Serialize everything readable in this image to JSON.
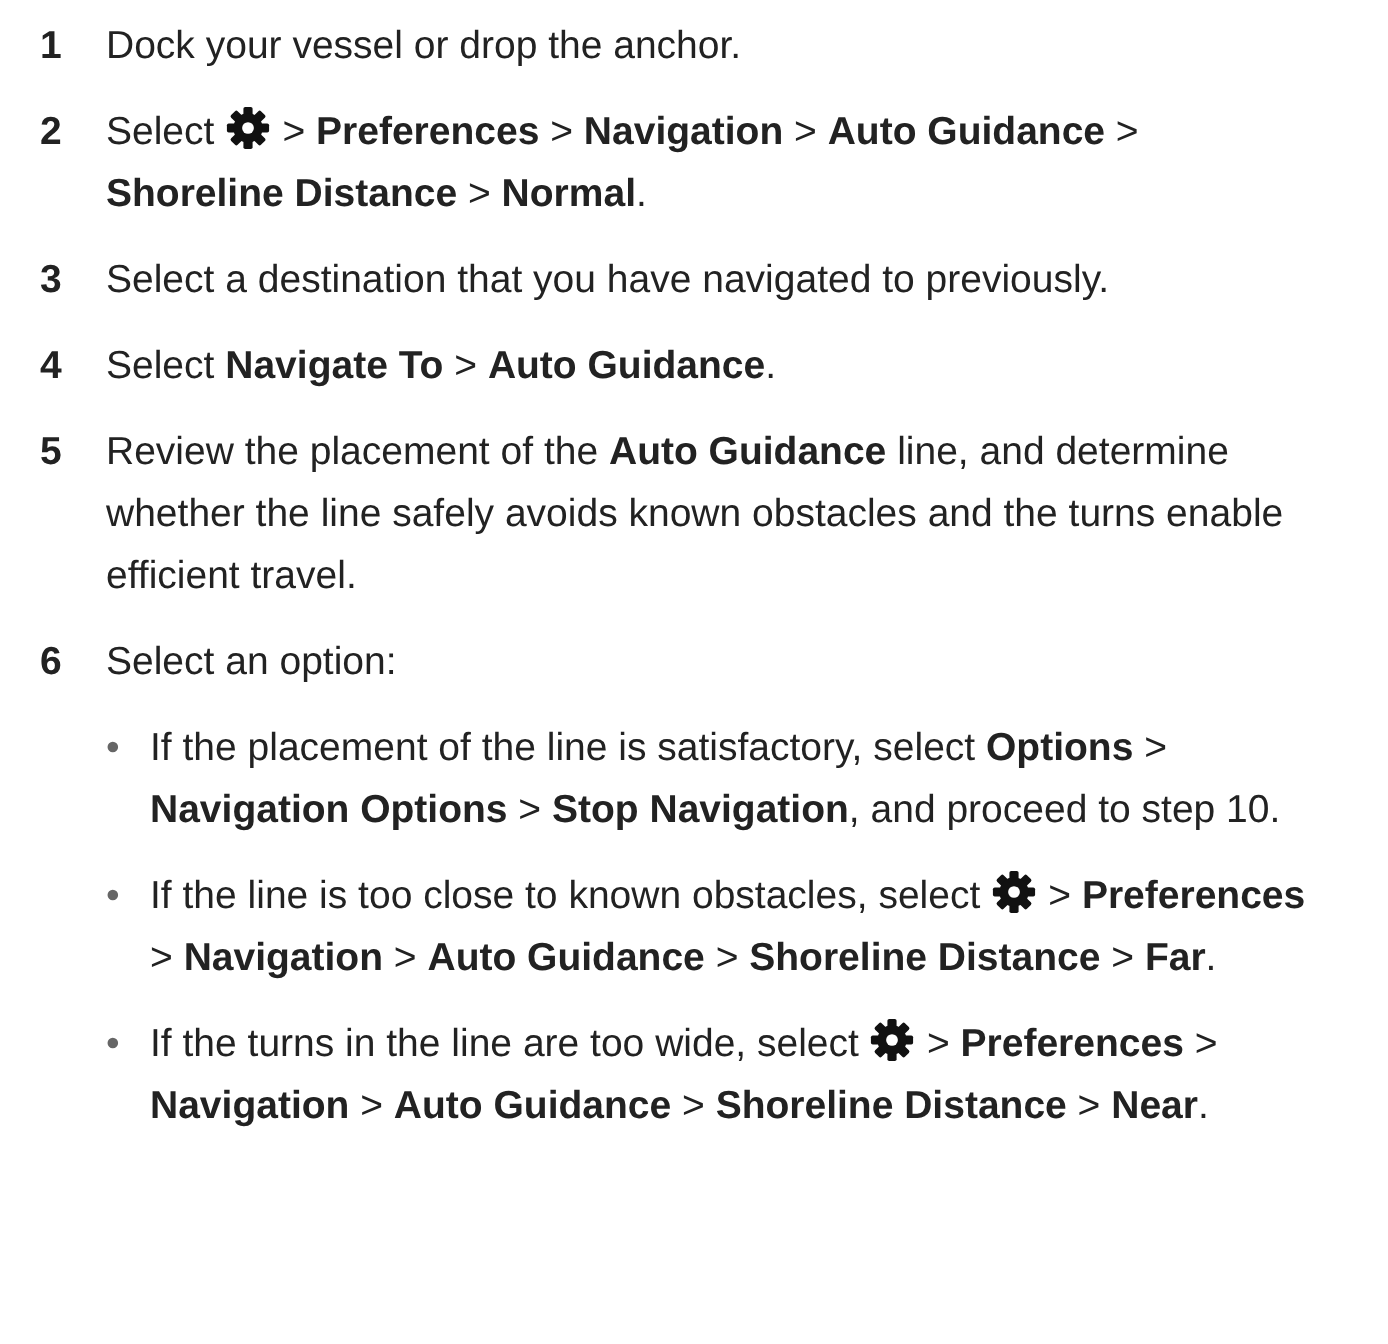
{
  "steps": [
    {
      "number": "1",
      "segments": [
        {
          "kind": "text",
          "text": "Dock your vessel or drop the anchor."
        }
      ]
    },
    {
      "number": "2",
      "segments": [
        {
          "kind": "text",
          "text": "Select"
        },
        {
          "kind": "gear"
        },
        {
          "kind": "text",
          "text": "> **Preferences** > **Navigation** > **Auto Guidance** > **Shoreline Distance** > **Normal**."
        }
      ]
    },
    {
      "number": "3",
      "segments": [
        {
          "kind": "text",
          "text": "Select a destination that you have navigated to previously."
        }
      ]
    },
    {
      "number": "4",
      "segments": [
        {
          "kind": "text",
          "text": "Select **Navigate To** > **Auto Guidance**."
        }
      ]
    },
    {
      "number": "5",
      "segments": [
        {
          "kind": "text",
          "text": "Review the placement of the **Auto Guidance** line, and determine whether the line safely avoids known obstacles and the turns enable efficient travel."
        }
      ]
    },
    {
      "number": "6",
      "segments": [
        {
          "kind": "text",
          "text": "Select an option:"
        }
      ],
      "options": [
        {
          "bullet": "•",
          "segments": [
            {
              "kind": "text",
              "text": "If the placement of the line is satisfactory, select **Options** > **Navigation Options** > **Stop Navigation**, and proceed to step 10."
            }
          ]
        },
        {
          "bullet": "•",
          "segments": [
            {
              "kind": "text",
              "text": "If the line is too close to known obstacles, select"
            },
            {
              "kind": "gear"
            },
            {
              "kind": "text",
              "text": "> **Preferences** > **Navigation** > **Auto Guidance** > **Shoreline Distance** > **Far**."
            }
          ]
        },
        {
          "bullet": "•",
          "segments": [
            {
              "kind": "text",
              "text": "If the turns in the line are too wide, select"
            },
            {
              "kind": "gear"
            },
            {
              "kind": "text",
              "text": "> **Preferences** > **Navigation** > **Auto Guidance** > **Shoreline Distance** > **Near**."
            }
          ]
        }
      ]
    }
  ]
}
